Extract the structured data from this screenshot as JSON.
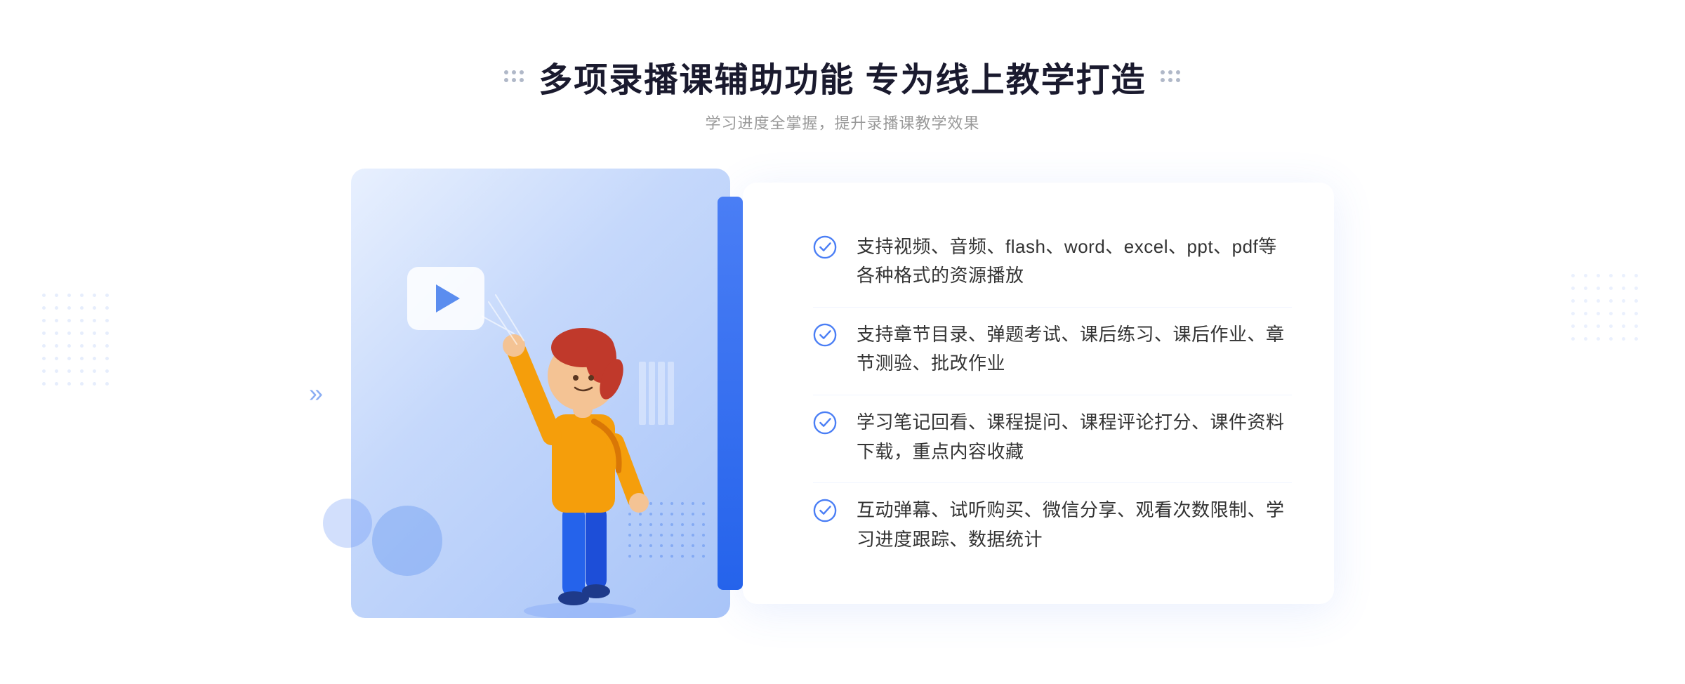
{
  "header": {
    "title": "多项录播课辅助功能 专为线上教学打造",
    "subtitle": "学习进度全掌握，提升录播课教学效果"
  },
  "features": [
    {
      "id": 1,
      "text": "支持视频、音频、flash、word、excel、ppt、pdf等各种格式的资源播放"
    },
    {
      "id": 2,
      "text": "支持章节目录、弹题考试、课后练习、课后作业、章节测验、批改作业"
    },
    {
      "id": 3,
      "text": "学习笔记回看、课程提问、课程评论打分、课件资料下载，重点内容收藏"
    },
    {
      "id": 4,
      "text": "互动弹幕、试听购买、微信分享、观看次数限制、学习进度跟踪、数据统计"
    }
  ],
  "icons": {
    "check": "check-circle-icon",
    "play": "play-icon",
    "chevron": "chevron-right-icon"
  },
  "colors": {
    "primary": "#4a7ef5",
    "primaryDark": "#2563eb",
    "text": "#333333",
    "textLight": "#999999",
    "bgLight": "#e8f0fe"
  }
}
